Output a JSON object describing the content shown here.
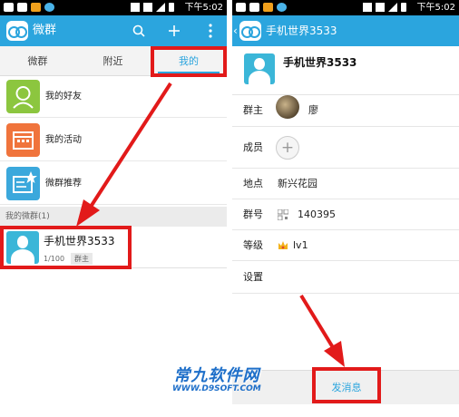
{
  "status_bar": {
    "time": "下午5:02"
  },
  "left_screen": {
    "app_title": "微群",
    "actions": {
      "search": "search-icon",
      "add": "plus-icon",
      "more": "more-icon"
    },
    "tabs": [
      {
        "label": "微群"
      },
      {
        "label": "附近"
      },
      {
        "label": "我的",
        "active": true
      }
    ],
    "menu": [
      {
        "label": "我的好友",
        "icon_color": "#8cc63f"
      },
      {
        "label": "我的活动",
        "icon_color": "#f0743c"
      },
      {
        "label": "微群推荐",
        "icon_color": "#3ba8dc"
      }
    ],
    "section_header": "我的微群(1)",
    "group": {
      "name": "手机世界3533",
      "count": "1/100",
      "badge": "群主"
    }
  },
  "right_screen": {
    "back_title": "手机世界3533",
    "group_name": "手机世界3533",
    "rows": {
      "owner": {
        "label": "群主",
        "value": "廖"
      },
      "members": {
        "label": "成员",
        "add": "+"
      },
      "location": {
        "label": "地点",
        "value": "新兴花园"
      },
      "group_no": {
        "label": "群号",
        "value": "140395"
      },
      "level": {
        "label": "等级",
        "value": "lv1"
      },
      "settings": {
        "label": "设置"
      }
    },
    "send_button": "发消息"
  },
  "watermark": {
    "line1": "常九软件网",
    "line2": "WWW.D9SOFT.COM"
  },
  "colors": {
    "accent": "#2ba5de",
    "highlight": "#e21a1a"
  }
}
